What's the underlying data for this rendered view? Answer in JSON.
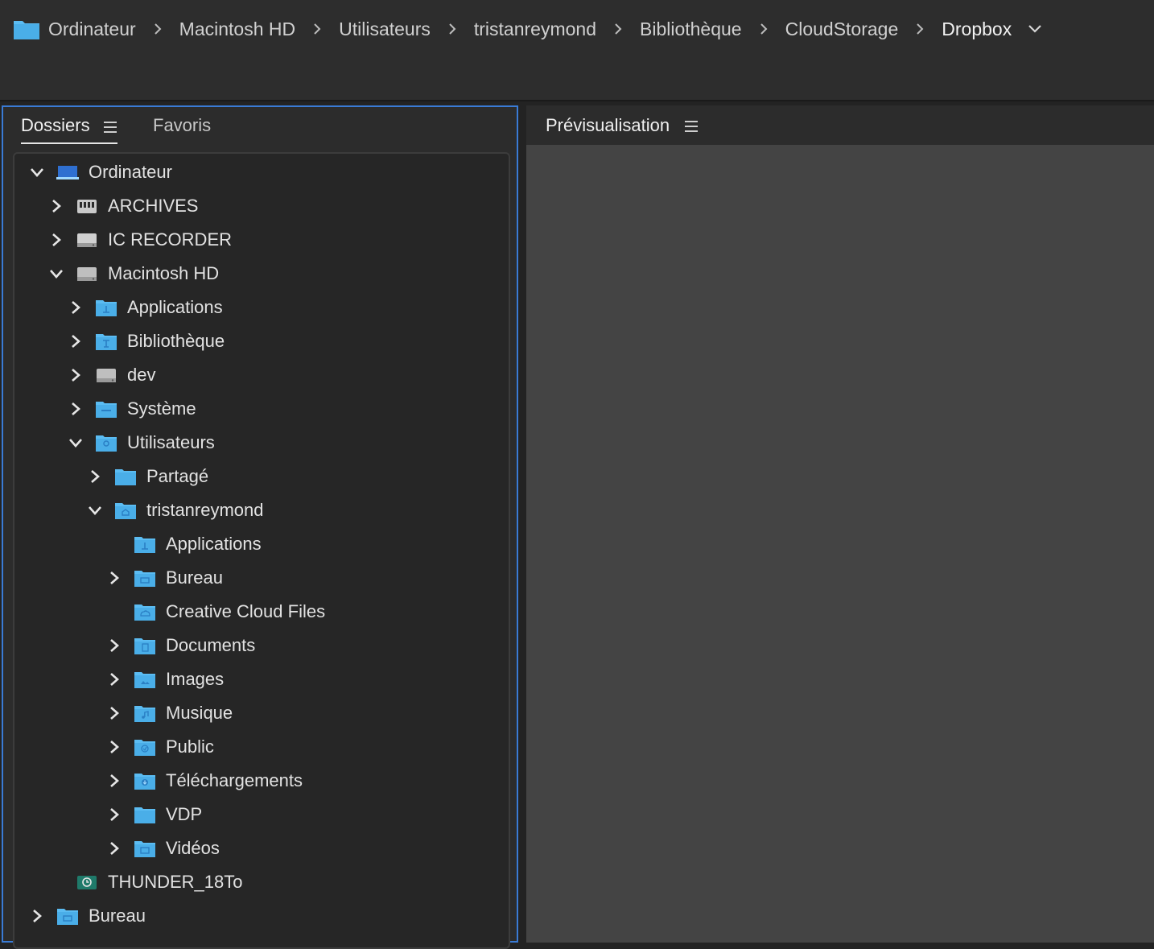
{
  "path": {
    "crumbs": [
      "Ordinateur",
      "Macintosh HD",
      "Utilisateurs",
      "tristanreymond",
      "Bibliothèque",
      "CloudStorage",
      "Dropbox"
    ]
  },
  "left_panel": {
    "tabs": [
      {
        "label": "Dossiers",
        "active": true
      },
      {
        "label": "Favoris",
        "active": false
      }
    ]
  },
  "tree": [
    {
      "label": "Ordinateur",
      "depth": 0,
      "expand": "open",
      "icon": "computer-icon"
    },
    {
      "label": "ARCHIVES",
      "depth": 1,
      "expand": "closed",
      "icon": "nas-drive-icon"
    },
    {
      "label": "IC RECORDER",
      "depth": 1,
      "expand": "closed",
      "icon": "removable-drive-icon"
    },
    {
      "label": "Macintosh HD",
      "depth": 1,
      "expand": "open",
      "icon": "hard-drive-icon"
    },
    {
      "label": "Applications",
      "depth": 2,
      "expand": "closed",
      "icon": "applications-folder-icon"
    },
    {
      "label": "Bibliothèque",
      "depth": 2,
      "expand": "closed",
      "icon": "library-folder-icon"
    },
    {
      "label": "dev",
      "depth": 2,
      "expand": "closed",
      "icon": "hard-drive-icon"
    },
    {
      "label": "Système",
      "depth": 2,
      "expand": "closed",
      "icon": "system-folder-icon"
    },
    {
      "label": "Utilisateurs",
      "depth": 2,
      "expand": "open",
      "icon": "users-folder-icon"
    },
    {
      "label": "Partagé",
      "depth": 3,
      "expand": "closed",
      "icon": "folder-icon"
    },
    {
      "label": "tristanreymond",
      "depth": 3,
      "expand": "open",
      "icon": "home-folder-icon"
    },
    {
      "label": "Applications",
      "depth": 4,
      "expand": "none",
      "icon": "applications-folder-icon"
    },
    {
      "label": "Bureau",
      "depth": 4,
      "expand": "closed",
      "icon": "desktop-folder-icon"
    },
    {
      "label": "Creative Cloud Files",
      "depth": 4,
      "expand": "none",
      "icon": "creative-cloud-folder-icon"
    },
    {
      "label": "Documents",
      "depth": 4,
      "expand": "closed",
      "icon": "documents-folder-icon"
    },
    {
      "label": "Images",
      "depth": 4,
      "expand": "closed",
      "icon": "pictures-folder-icon"
    },
    {
      "label": "Musique",
      "depth": 4,
      "expand": "closed",
      "icon": "music-folder-icon"
    },
    {
      "label": "Public",
      "depth": 4,
      "expand": "closed",
      "icon": "public-folder-icon"
    },
    {
      "label": "Téléchargements",
      "depth": 4,
      "expand": "closed",
      "icon": "downloads-folder-icon"
    },
    {
      "label": "VDP",
      "depth": 4,
      "expand": "closed",
      "icon": "folder-icon"
    },
    {
      "label": "Vidéos",
      "depth": 4,
      "expand": "closed",
      "icon": "movies-folder-icon"
    },
    {
      "label": "THUNDER_18To",
      "depth": 1,
      "expand": "none",
      "icon": "time-machine-drive-icon"
    },
    {
      "label": "Bureau",
      "depth": 0,
      "expand": "closed",
      "icon": "desktop-folder-icon"
    }
  ],
  "preview": {
    "title": "Prévisualisation"
  },
  "colors": {
    "folder_blue": "#5bbcf2",
    "panel_focus_border": "#3a7bd5",
    "preview_bg": "#444444"
  }
}
